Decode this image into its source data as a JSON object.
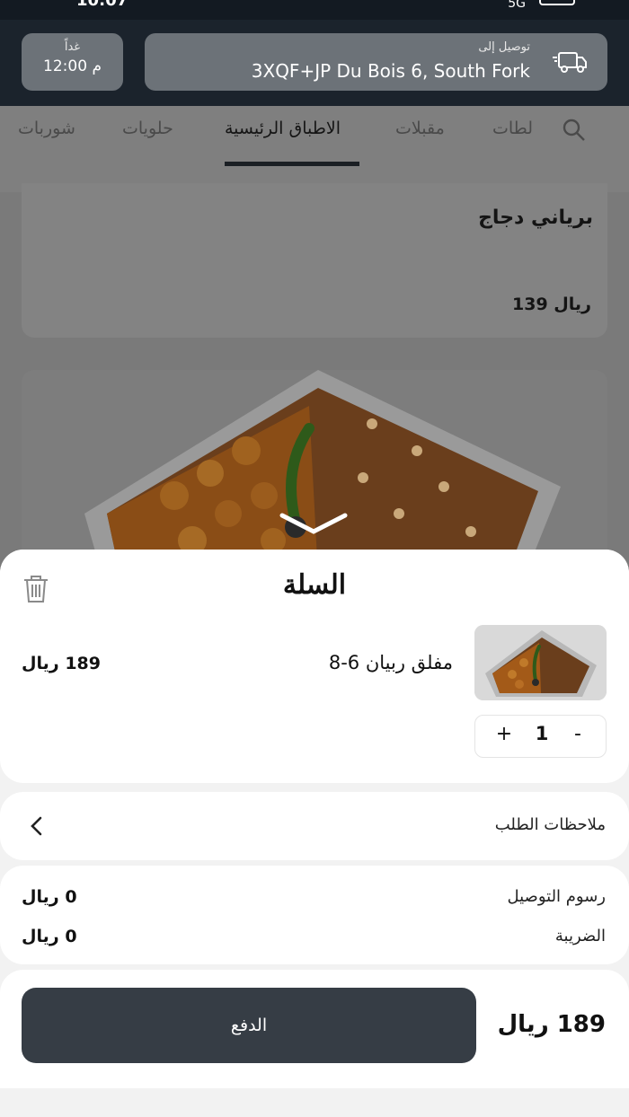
{
  "status_bar": {
    "time": "10:07",
    "signal": "5G"
  },
  "header": {
    "schedule": {
      "day": "غداً",
      "time": "12:00 م"
    },
    "delivery": {
      "label": "توصيل إلى",
      "address": "3XQF+JP Du Bois 6, South Fork",
      "icon": "truck-icon"
    }
  },
  "tabs": [
    {
      "label": "لطات",
      "active": false
    },
    {
      "label": "مقبلات",
      "active": false
    },
    {
      "label": "الاطباق الرئيسية",
      "active": true
    },
    {
      "label": "حلويات",
      "active": false
    },
    {
      "label": "شوربات",
      "active": false
    }
  ],
  "menu": {
    "item1": {
      "name": "برياني دجاج",
      "price": "139 ريال"
    }
  },
  "cart": {
    "title": "السلة",
    "item": {
      "name": "مفلق ربيان 6-8",
      "price": "189 ريال",
      "quantity": "1",
      "plus": "+",
      "minus": "-"
    },
    "notes_label": "ملاحظات الطلب",
    "fees": [
      {
        "label": "رسوم التوصيل",
        "value": "0 ريال"
      },
      {
        "label": "الضريبة",
        "value": "0 ريال"
      }
    ],
    "total": "189 ريال",
    "pay_label": "الدفع"
  },
  "colors": {
    "header_bg": "#1b232c",
    "pay_button": "#363d45",
    "sheet_bg": "#ffffff"
  }
}
